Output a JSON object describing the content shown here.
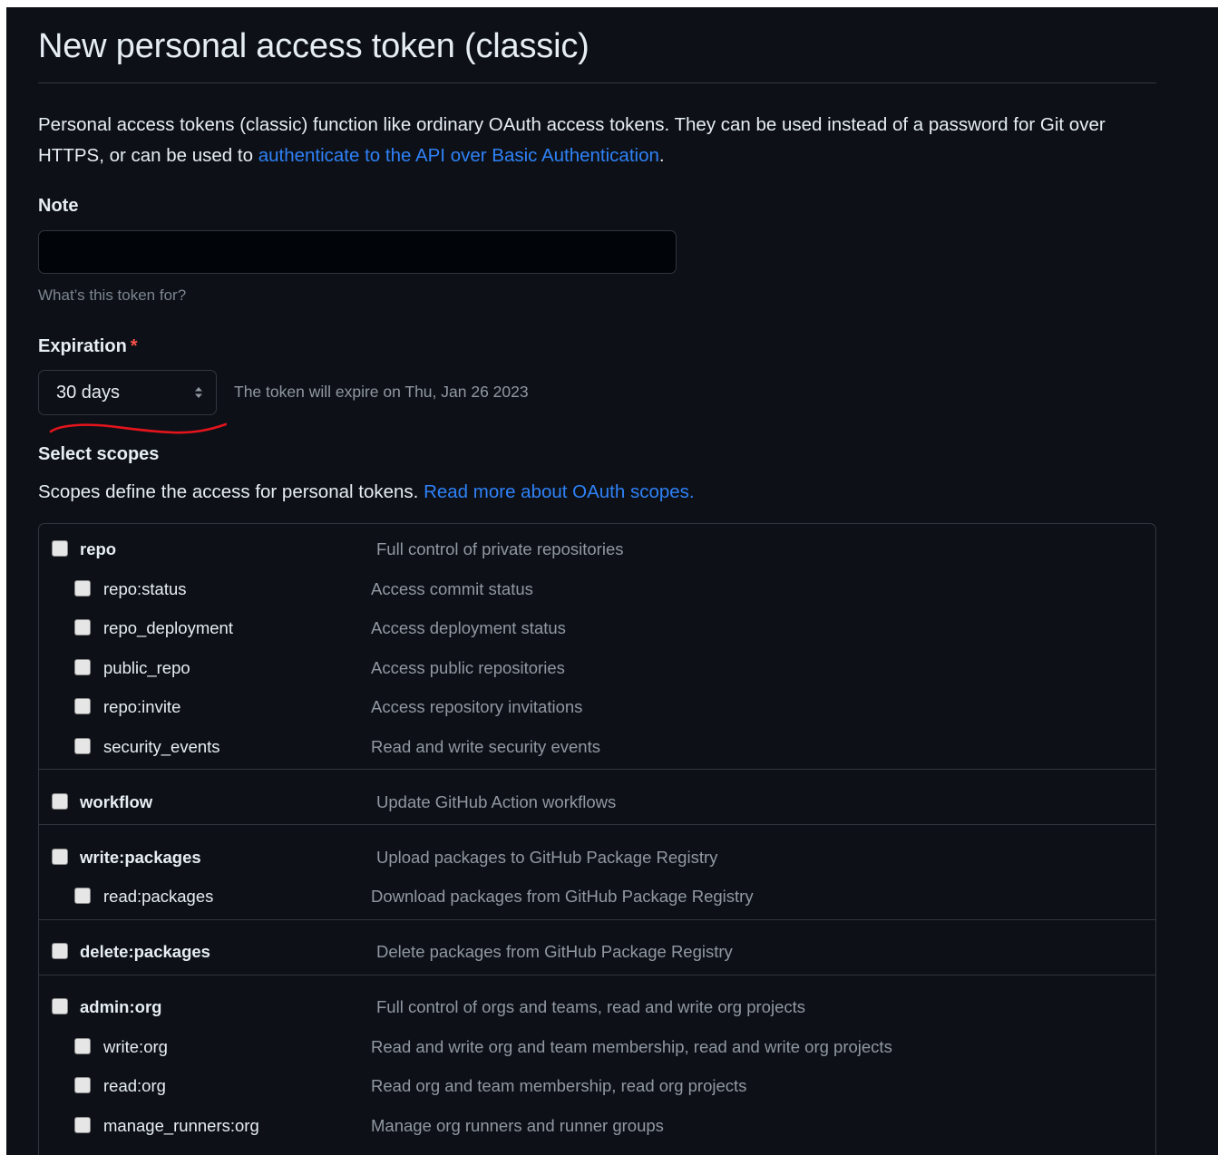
{
  "page": {
    "title": "New personal access token (classic)",
    "intro_text": "Personal access tokens (classic) function like ordinary OAuth access tokens. They can be used instead of a password for Git over HTTPS, or can be used to ",
    "intro_link": "authenticate to the API over Basic Authentication",
    "intro_end": "."
  },
  "note": {
    "label": "Note",
    "value": "",
    "placeholder": "",
    "hint": "What’s this token for?"
  },
  "expiration": {
    "label": "Expiration",
    "required_mark": "*",
    "selected": "30 days",
    "expire_text": "The token will expire on Thu, Jan 26 2023"
  },
  "scopes": {
    "heading": "Select scopes",
    "description": "Scopes define the access for personal tokens. ",
    "description_link": "Read more about OAuth scopes.",
    "groups": [
      {
        "name": "repo",
        "desc": "Full control of private repositories",
        "children": [
          {
            "name": "repo:status",
            "desc": "Access commit status"
          },
          {
            "name": "repo_deployment",
            "desc": "Access deployment status"
          },
          {
            "name": "public_repo",
            "desc": "Access public repositories"
          },
          {
            "name": "repo:invite",
            "desc": "Access repository invitations"
          },
          {
            "name": "security_events",
            "desc": "Read and write security events"
          }
        ]
      },
      {
        "name": "workflow",
        "desc": "Update GitHub Action workflows",
        "children": []
      },
      {
        "name": "write:packages",
        "desc": "Upload packages to GitHub Package Registry",
        "children": [
          {
            "name": "read:packages",
            "desc": "Download packages from GitHub Package Registry"
          }
        ]
      },
      {
        "name": "delete:packages",
        "desc": "Delete packages from GitHub Package Registry",
        "children": []
      },
      {
        "name": "admin:org",
        "desc": "Full control of orgs and teams, read and write org projects",
        "children": [
          {
            "name": "write:org",
            "desc": "Read and write org and team membership, read and write org projects"
          },
          {
            "name": "read:org",
            "desc": "Read org and team membership, read org projects"
          },
          {
            "name": "manage_runners:org",
            "desc": "Manage org runners and runner groups"
          }
        ]
      }
    ]
  },
  "colors": {
    "background": "#0d1117",
    "text": "#e6edf3",
    "muted": "#9198a1",
    "link": "#2f81f7",
    "border": "#30363d",
    "required": "#f85149",
    "annotation": "#e5141c"
  }
}
